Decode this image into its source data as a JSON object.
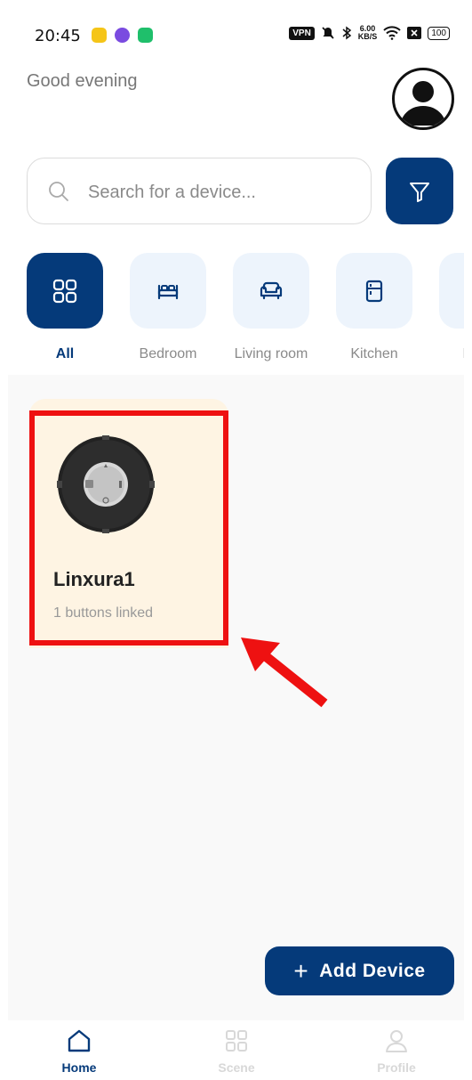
{
  "status_bar": {
    "time": "20:45",
    "vpn": "VPN",
    "net_speed_value": "6.00",
    "net_speed_unit": "KB/S",
    "battery": "100"
  },
  "greeting": "Good evening",
  "search": {
    "placeholder": "Search for a device..."
  },
  "categories": [
    {
      "label": "All",
      "icon": "grid-icon",
      "active": true
    },
    {
      "label": "Bedroom",
      "icon": "bed-icon"
    },
    {
      "label": "Living room",
      "icon": "sofa-icon"
    },
    {
      "label": "Kitchen",
      "icon": "fridge-icon"
    },
    {
      "label": "Bath",
      "icon": "bath-icon"
    }
  ],
  "devices": [
    {
      "name": "Linxura1",
      "subtitle": "1 buttons linked",
      "image": "round-smart-controller"
    }
  ],
  "add_device": {
    "label": "Add Device",
    "icon": "plus-icon"
  },
  "bottom_nav": [
    {
      "label": "Home",
      "icon": "home-icon",
      "active": true
    },
    {
      "label": "Scene",
      "icon": "grid-icon"
    },
    {
      "label": "Profile",
      "icon": "person-icon"
    }
  ],
  "colors": {
    "primary": "#053a7a",
    "category_bg": "#edf4fc",
    "card_bg": "#fef4e3",
    "highlight": "#ee1111"
  }
}
